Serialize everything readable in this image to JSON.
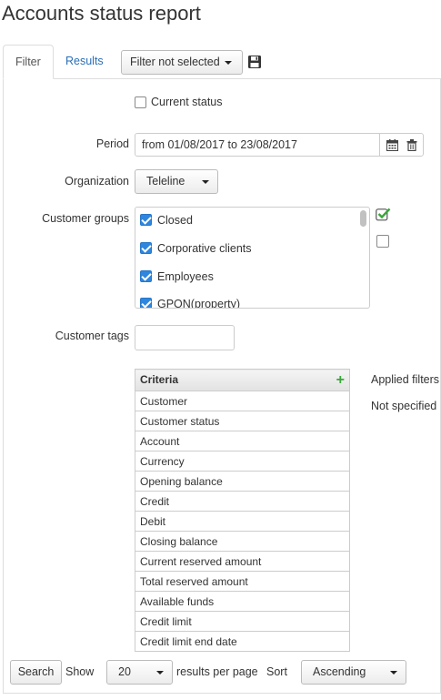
{
  "page": {
    "title": "Accounts status report"
  },
  "tabs": {
    "filter": "Filter",
    "results": "Results"
  },
  "filter_select": {
    "value": "Filter not selected"
  },
  "icons": {
    "save": "save-icon",
    "calendar": "calendar-icon",
    "trash": "trash-icon",
    "check_all": "check-all-icon",
    "uncheck_all": "uncheck-all-icon",
    "add": "plus-icon"
  },
  "current_status": {
    "label": "Current status",
    "checked": false
  },
  "period": {
    "label": "Period",
    "value": "from 01/08/2017 to 23/08/2017"
  },
  "organization": {
    "label": "Organization",
    "value": "Teleline"
  },
  "customer_groups": {
    "label": "Customer groups",
    "items": [
      {
        "label": "Closed",
        "checked": true
      },
      {
        "label": "Corporative clients",
        "checked": true
      },
      {
        "label": "Employees",
        "checked": true
      },
      {
        "label": "GPON(property)",
        "checked": true
      }
    ]
  },
  "customer_tags": {
    "label": "Customer tags",
    "value": ""
  },
  "criteria": {
    "header": "Criteria",
    "rows": [
      "Customer",
      "Customer status",
      "Account",
      "Currency",
      "Opening balance",
      "Credit",
      "Debit",
      "Closing balance",
      "Current reserved amount",
      "Total reserved amount",
      "Available funds",
      "Credit limit",
      "Credit limit end date"
    ]
  },
  "applied_filters": {
    "label": "Applied filters",
    "value": "Not specified"
  },
  "footer": {
    "search_label": "Search",
    "show_label": "Show",
    "per_page_value": "20",
    "per_page_suffix": "results per page",
    "sort_label": "Sort",
    "sort_value": "Ascending"
  },
  "colors": {
    "accent": "#2e86de",
    "link": "#2a6fb7",
    "add_green": "#3aa63a"
  }
}
